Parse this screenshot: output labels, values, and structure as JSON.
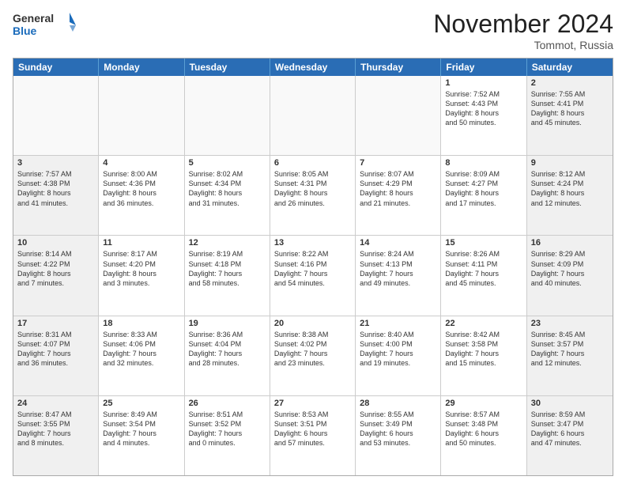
{
  "logo": {
    "line1": "General",
    "line2": "Blue"
  },
  "header": {
    "month": "November 2024",
    "location": "Tommot, Russia"
  },
  "days_of_week": [
    "Sunday",
    "Monday",
    "Tuesday",
    "Wednesday",
    "Thursday",
    "Friday",
    "Saturday"
  ],
  "weeks": [
    [
      {
        "day": "",
        "info": ""
      },
      {
        "day": "",
        "info": ""
      },
      {
        "day": "",
        "info": ""
      },
      {
        "day": "",
        "info": ""
      },
      {
        "day": "",
        "info": ""
      },
      {
        "day": "1",
        "info": "Sunrise: 7:52 AM\nSunset: 4:43 PM\nDaylight: 8 hours\nand 50 minutes."
      },
      {
        "day": "2",
        "info": "Sunrise: 7:55 AM\nSunset: 4:41 PM\nDaylight: 8 hours\nand 45 minutes."
      }
    ],
    [
      {
        "day": "3",
        "info": "Sunrise: 7:57 AM\nSunset: 4:38 PM\nDaylight: 8 hours\nand 41 minutes."
      },
      {
        "day": "4",
        "info": "Sunrise: 8:00 AM\nSunset: 4:36 PM\nDaylight: 8 hours\nand 36 minutes."
      },
      {
        "day": "5",
        "info": "Sunrise: 8:02 AM\nSunset: 4:34 PM\nDaylight: 8 hours\nand 31 minutes."
      },
      {
        "day": "6",
        "info": "Sunrise: 8:05 AM\nSunset: 4:31 PM\nDaylight: 8 hours\nand 26 minutes."
      },
      {
        "day": "7",
        "info": "Sunrise: 8:07 AM\nSunset: 4:29 PM\nDaylight: 8 hours\nand 21 minutes."
      },
      {
        "day": "8",
        "info": "Sunrise: 8:09 AM\nSunset: 4:27 PM\nDaylight: 8 hours\nand 17 minutes."
      },
      {
        "day": "9",
        "info": "Sunrise: 8:12 AM\nSunset: 4:24 PM\nDaylight: 8 hours\nand 12 minutes."
      }
    ],
    [
      {
        "day": "10",
        "info": "Sunrise: 8:14 AM\nSunset: 4:22 PM\nDaylight: 8 hours\nand 7 minutes."
      },
      {
        "day": "11",
        "info": "Sunrise: 8:17 AM\nSunset: 4:20 PM\nDaylight: 8 hours\nand 3 minutes."
      },
      {
        "day": "12",
        "info": "Sunrise: 8:19 AM\nSunset: 4:18 PM\nDaylight: 7 hours\nand 58 minutes."
      },
      {
        "day": "13",
        "info": "Sunrise: 8:22 AM\nSunset: 4:16 PM\nDaylight: 7 hours\nand 54 minutes."
      },
      {
        "day": "14",
        "info": "Sunrise: 8:24 AM\nSunset: 4:13 PM\nDaylight: 7 hours\nand 49 minutes."
      },
      {
        "day": "15",
        "info": "Sunrise: 8:26 AM\nSunset: 4:11 PM\nDaylight: 7 hours\nand 45 minutes."
      },
      {
        "day": "16",
        "info": "Sunrise: 8:29 AM\nSunset: 4:09 PM\nDaylight: 7 hours\nand 40 minutes."
      }
    ],
    [
      {
        "day": "17",
        "info": "Sunrise: 8:31 AM\nSunset: 4:07 PM\nDaylight: 7 hours\nand 36 minutes."
      },
      {
        "day": "18",
        "info": "Sunrise: 8:33 AM\nSunset: 4:06 PM\nDaylight: 7 hours\nand 32 minutes."
      },
      {
        "day": "19",
        "info": "Sunrise: 8:36 AM\nSunset: 4:04 PM\nDaylight: 7 hours\nand 28 minutes."
      },
      {
        "day": "20",
        "info": "Sunrise: 8:38 AM\nSunset: 4:02 PM\nDaylight: 7 hours\nand 23 minutes."
      },
      {
        "day": "21",
        "info": "Sunrise: 8:40 AM\nSunset: 4:00 PM\nDaylight: 7 hours\nand 19 minutes."
      },
      {
        "day": "22",
        "info": "Sunrise: 8:42 AM\nSunset: 3:58 PM\nDaylight: 7 hours\nand 15 minutes."
      },
      {
        "day": "23",
        "info": "Sunrise: 8:45 AM\nSunset: 3:57 PM\nDaylight: 7 hours\nand 12 minutes."
      }
    ],
    [
      {
        "day": "24",
        "info": "Sunrise: 8:47 AM\nSunset: 3:55 PM\nDaylight: 7 hours\nand 8 minutes."
      },
      {
        "day": "25",
        "info": "Sunrise: 8:49 AM\nSunset: 3:54 PM\nDaylight: 7 hours\nand 4 minutes."
      },
      {
        "day": "26",
        "info": "Sunrise: 8:51 AM\nSunset: 3:52 PM\nDaylight: 7 hours\nand 0 minutes."
      },
      {
        "day": "27",
        "info": "Sunrise: 8:53 AM\nSunset: 3:51 PM\nDaylight: 6 hours\nand 57 minutes."
      },
      {
        "day": "28",
        "info": "Sunrise: 8:55 AM\nSunset: 3:49 PM\nDaylight: 6 hours\nand 53 minutes."
      },
      {
        "day": "29",
        "info": "Sunrise: 8:57 AM\nSunset: 3:48 PM\nDaylight: 6 hours\nand 50 minutes."
      },
      {
        "day": "30",
        "info": "Sunrise: 8:59 AM\nSunset: 3:47 PM\nDaylight: 6 hours\nand 47 minutes."
      }
    ]
  ]
}
